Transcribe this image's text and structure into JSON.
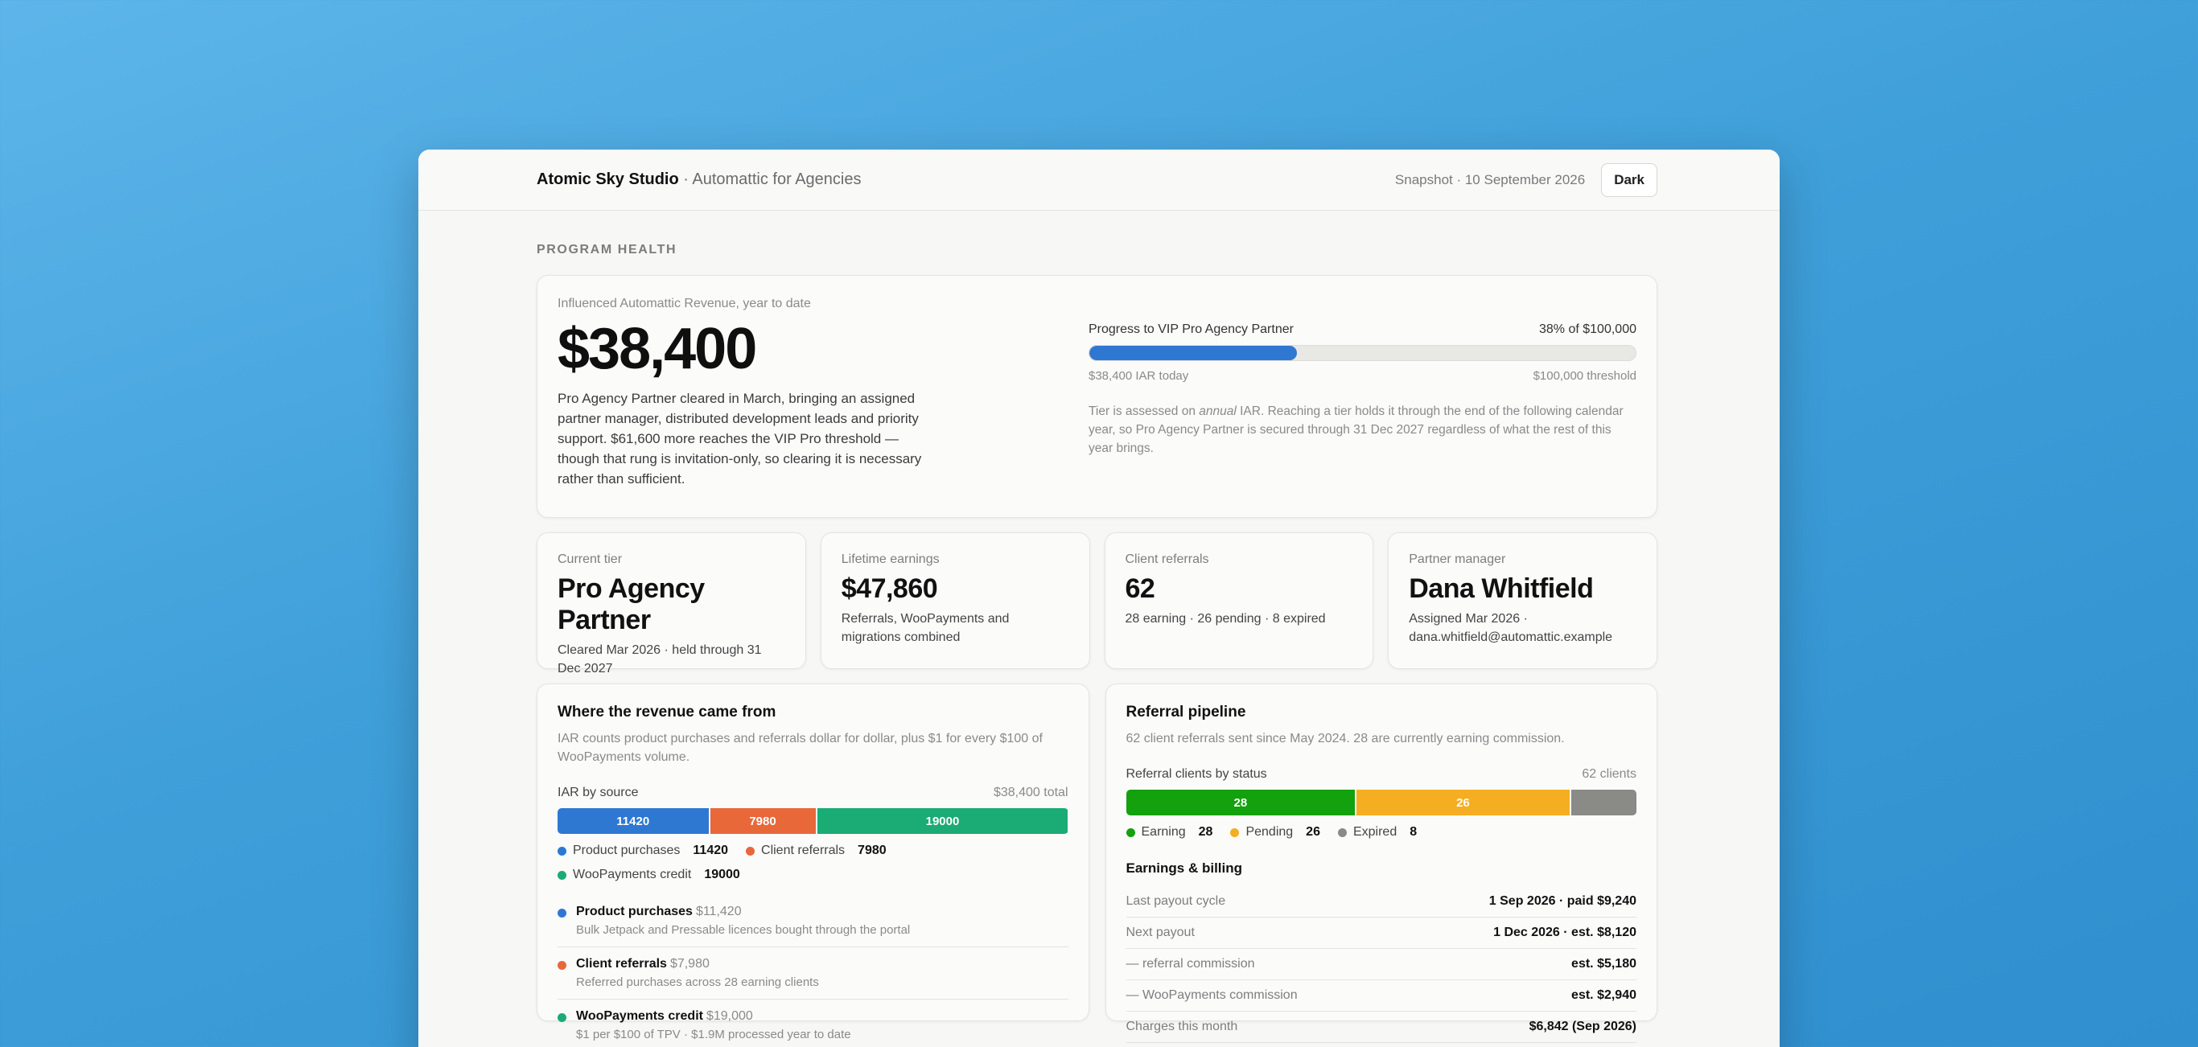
{
  "header": {
    "org_name": "Atomic Sky Studio",
    "separator": " · ",
    "program": "Automattic for Agencies",
    "snapshot": "Snapshot · 10 September 2026",
    "theme_toggle": "Dark"
  },
  "section_label": "PROGRAM HEALTH",
  "hero": {
    "label": "Influenced Automattic Revenue, year to date",
    "amount": "$38,400",
    "description": "Pro Agency Partner cleared in March, bringing an assigned partner manager, distributed development leads and priority support. $61,600 more reaches the VIP Pro threshold — though that rung is invitation-only, so clearing it is necessary rather than sufficient.",
    "progress_label": "Progress to VIP Pro Agency Partner",
    "progress_value_text": "38% of $100,000",
    "progress_fraction": 0.38,
    "progress_left": "$38,400 IAR today",
    "progress_right": "$100,000 threshold",
    "note_before": "Tier is assessed on ",
    "note_em": "annual",
    "note_after": " IAR. Reaching a tier holds it through the end of the following calendar year, so Pro Agency Partner is secured through 31 Dec 2027 regardless of what the rest of this year brings."
  },
  "stats": [
    {
      "label": "Current tier",
      "value": "Pro Agency Partner",
      "sub": "Cleared Mar 2026 · held through 31 Dec 2027"
    },
    {
      "label": "Lifetime earnings",
      "value": "$47,860",
      "sub": "Referrals, WooPayments and migrations combined"
    },
    {
      "label": "Client referrals",
      "value": "62",
      "sub": "28 earning · 26 pending · 8 expired"
    },
    {
      "label": "Partner manager",
      "value": "Dana Whitfield",
      "sub": "Assigned Mar 2026 · dana.whitfield@automattic.example"
    }
  ],
  "revenue": {
    "title": "Where the revenue came from",
    "description": "IAR counts product purchases and referrals dollar for dollar, plus $1 for every $100 of WooPayments volume.",
    "bar_label": "IAR by source",
    "bar_total": "$38,400 total",
    "segments": [
      {
        "name": "Product purchases",
        "value": 11420,
        "color": "#2e78d2"
      },
      {
        "name": "Client referrals",
        "value": 7980,
        "color": "#e8683a"
      },
      {
        "name": "WooPayments credit",
        "value": 19000,
        "color": "#1bab74"
      }
    ],
    "sources": [
      {
        "title": "Product purchases",
        "amount": "$11,420",
        "desc": "Bulk Jetpack and Pressable licences bought through the portal",
        "color": "#2e78d2"
      },
      {
        "title": "Client referrals",
        "amount": "$7,980",
        "desc": "Referred purchases across 28 earning clients",
        "color": "#e8683a"
      },
      {
        "title": "WooPayments credit",
        "amount": "$19,000",
        "desc": "$1 per $100 of TPV · $1.9M processed year to date",
        "color": "#1bab74"
      }
    ]
  },
  "pipeline": {
    "title": "Referral pipeline",
    "description": "62 client referrals sent since May 2024. 28 are currently earning commission.",
    "bar_label": "Referral clients by status",
    "bar_total": "62 clients",
    "segments": [
      {
        "name": "Earning",
        "value": 28,
        "color": "#13a10e"
      },
      {
        "name": "Pending",
        "value": 26,
        "color": "#f5ae22"
      },
      {
        "name": "Expired",
        "value": 8,
        "color": "#8a8a86"
      }
    ],
    "billing_title": "Earnings & billing",
    "billing_rows": [
      {
        "k": "Last payout cycle",
        "v": "1 Sep 2026 · paid $9,240"
      },
      {
        "k": "Next payout",
        "v": "1 Dec 2026 · est. $8,120"
      },
      {
        "k": "— referral commission",
        "v": "est. $5,180"
      },
      {
        "k": "— WooPayments commission",
        "v": "est. $2,940"
      },
      {
        "k": "Charges this month",
        "v": "$6,842 (Sep 2026)"
      }
    ]
  }
}
